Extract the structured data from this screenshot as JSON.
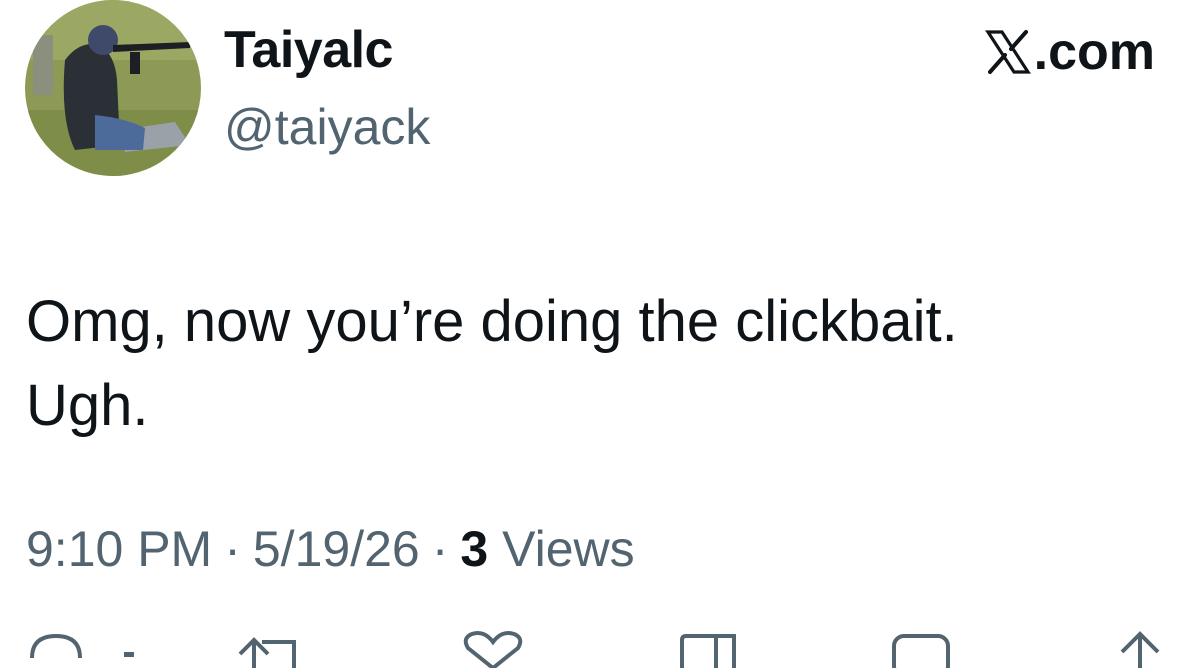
{
  "author": {
    "display_name": "Taiyalc",
    "handle": "@taiyack"
  },
  "brand": {
    "label": ".com",
    "icon": "x-logo-icon"
  },
  "tweet": {
    "text_line1": "Omg, now you’re doing the clickbait.",
    "text_line2": "Ugh."
  },
  "meta": {
    "time": "9:10 PM",
    "separator": "·",
    "date": "5/19/26",
    "views_count": "3",
    "views_label": "Views"
  },
  "actions": [
    {
      "icon": "reply-icon"
    },
    {
      "icon": "retweet-icon"
    },
    {
      "icon": "like-icon"
    },
    {
      "icon": "bookmark-icon"
    },
    {
      "icon": "chat-icon"
    },
    {
      "icon": "share-icon"
    }
  ],
  "colors": {
    "text_primary": "#0f1419",
    "text_secondary": "#536471"
  }
}
